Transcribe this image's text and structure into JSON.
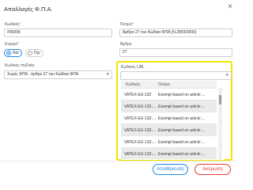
{
  "dialog": {
    "title": "Απαλλαγές Φ.Π.Α.",
    "close_glyph": "×"
  },
  "form": {
    "code_label": "Κωδικός",
    "code_value": "#00006",
    "name_label": "Όνομα",
    "name_value": "Άρθρο 27 του Κώδικα ΦΠΑ (Ν.2859/2000)",
    "active_label": "Ενεργό",
    "active_options": [
      "Ναι",
      "Όχι"
    ],
    "active_selected": "Ναι",
    "article_label": "Άρθρο",
    "article_value": "27",
    "mydata_label": "Κωδικός myData",
    "mydata_value": "Χωρίς ΦΠΑ - άρθρο 27 του Κώδικα ΦΠΑ",
    "ubl_label": "Κωδικός UBL",
    "ubl_value": ""
  },
  "ubl_list": {
    "columns": [
      "Κωδικός",
      "Όνομα"
    ],
    "rows": [
      {
        "code": "VATEX-EU-132",
        "name": "Exempt based on article ..."
      },
      {
        "code": "VATEX-EU-132-...",
        "name": "Exempt based on article ..."
      },
      {
        "code": "VATEX-EU-132-...",
        "name": "Exempt based on article ..."
      },
      {
        "code": "VATEX-EU-132-...",
        "name": "Exempt based on article ..."
      },
      {
        "code": "VATEX-EU-132-...",
        "name": "Exempt based on article ..."
      },
      {
        "code": "VATEX-EU-132-...",
        "name": "Exempt based on article ..."
      }
    ]
  },
  "buttons": {
    "save": "Αποθήκευση",
    "cancel": "Ακύρωση"
  },
  "colors": {
    "primary": "#1e88e5",
    "danger": "#e53935",
    "highlight": "#f2e500",
    "required": "#d9534f"
  },
  "icons": {
    "close": "close-icon",
    "caret": "chevron-down-icon"
  }
}
